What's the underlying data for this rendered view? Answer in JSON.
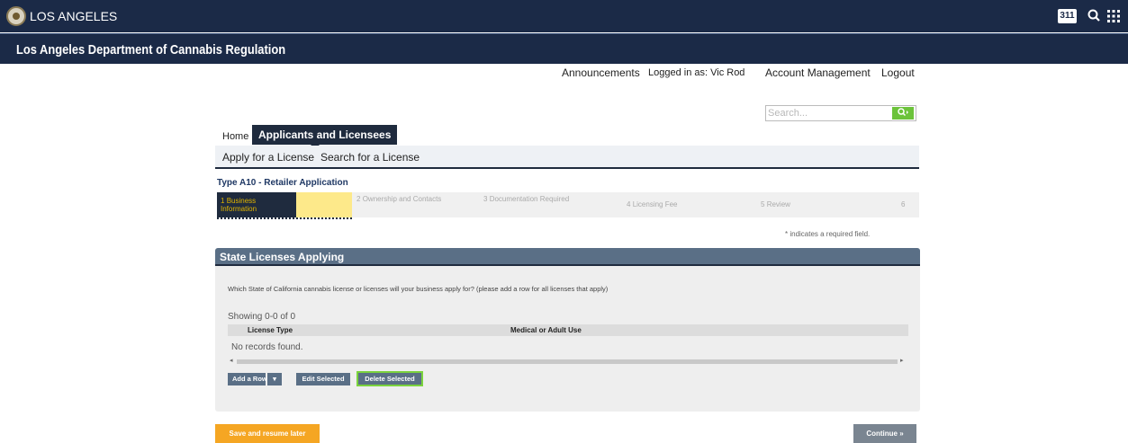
{
  "city": {
    "name": "LOS ANGELES",
    "badge_311": "311"
  },
  "department": {
    "title": "Los Angeles Department of Cannabis Regulation"
  },
  "toplinks": {
    "announcements": "Announcements",
    "logged_in": "Logged in as: Vic Rod",
    "account": "Account Management",
    "logout": "Logout"
  },
  "search": {
    "placeholder": "Search..."
  },
  "tabs": {
    "home": "Home",
    "applicants": "Applicants and Licensees"
  },
  "subnav": {
    "apply": "Apply for a License",
    "search": "Search for a License"
  },
  "application": {
    "title": "Type A10 - Retailer Application",
    "steps": [
      {
        "num": "1",
        "label": "Business Information"
      },
      {
        "num": "2",
        "label": "Ownership and Contacts"
      },
      {
        "num": "3",
        "label": "Documentation Required"
      },
      {
        "num": "4",
        "label": "Licensing Fee"
      },
      {
        "num": "5",
        "label": "Review"
      },
      {
        "num": "6",
        "label": ""
      }
    ],
    "required_note": "* indicates a required field."
  },
  "panel": {
    "title": "State Licenses Applying",
    "question": "Which State of California cannabis license or licenses will your business apply for? (please add a row for all licenses that apply)",
    "showing": "Showing 0-0 of 0",
    "columns": [
      "License Type",
      "Medical or Adult Use"
    ],
    "empty_text": "No records found.",
    "buttons": {
      "add_row": "Add a Row",
      "edit": "Edit Selected",
      "delete": "Delete Selected"
    }
  },
  "footer": {
    "save": "Save and resume later",
    "continue": "Continue »"
  }
}
